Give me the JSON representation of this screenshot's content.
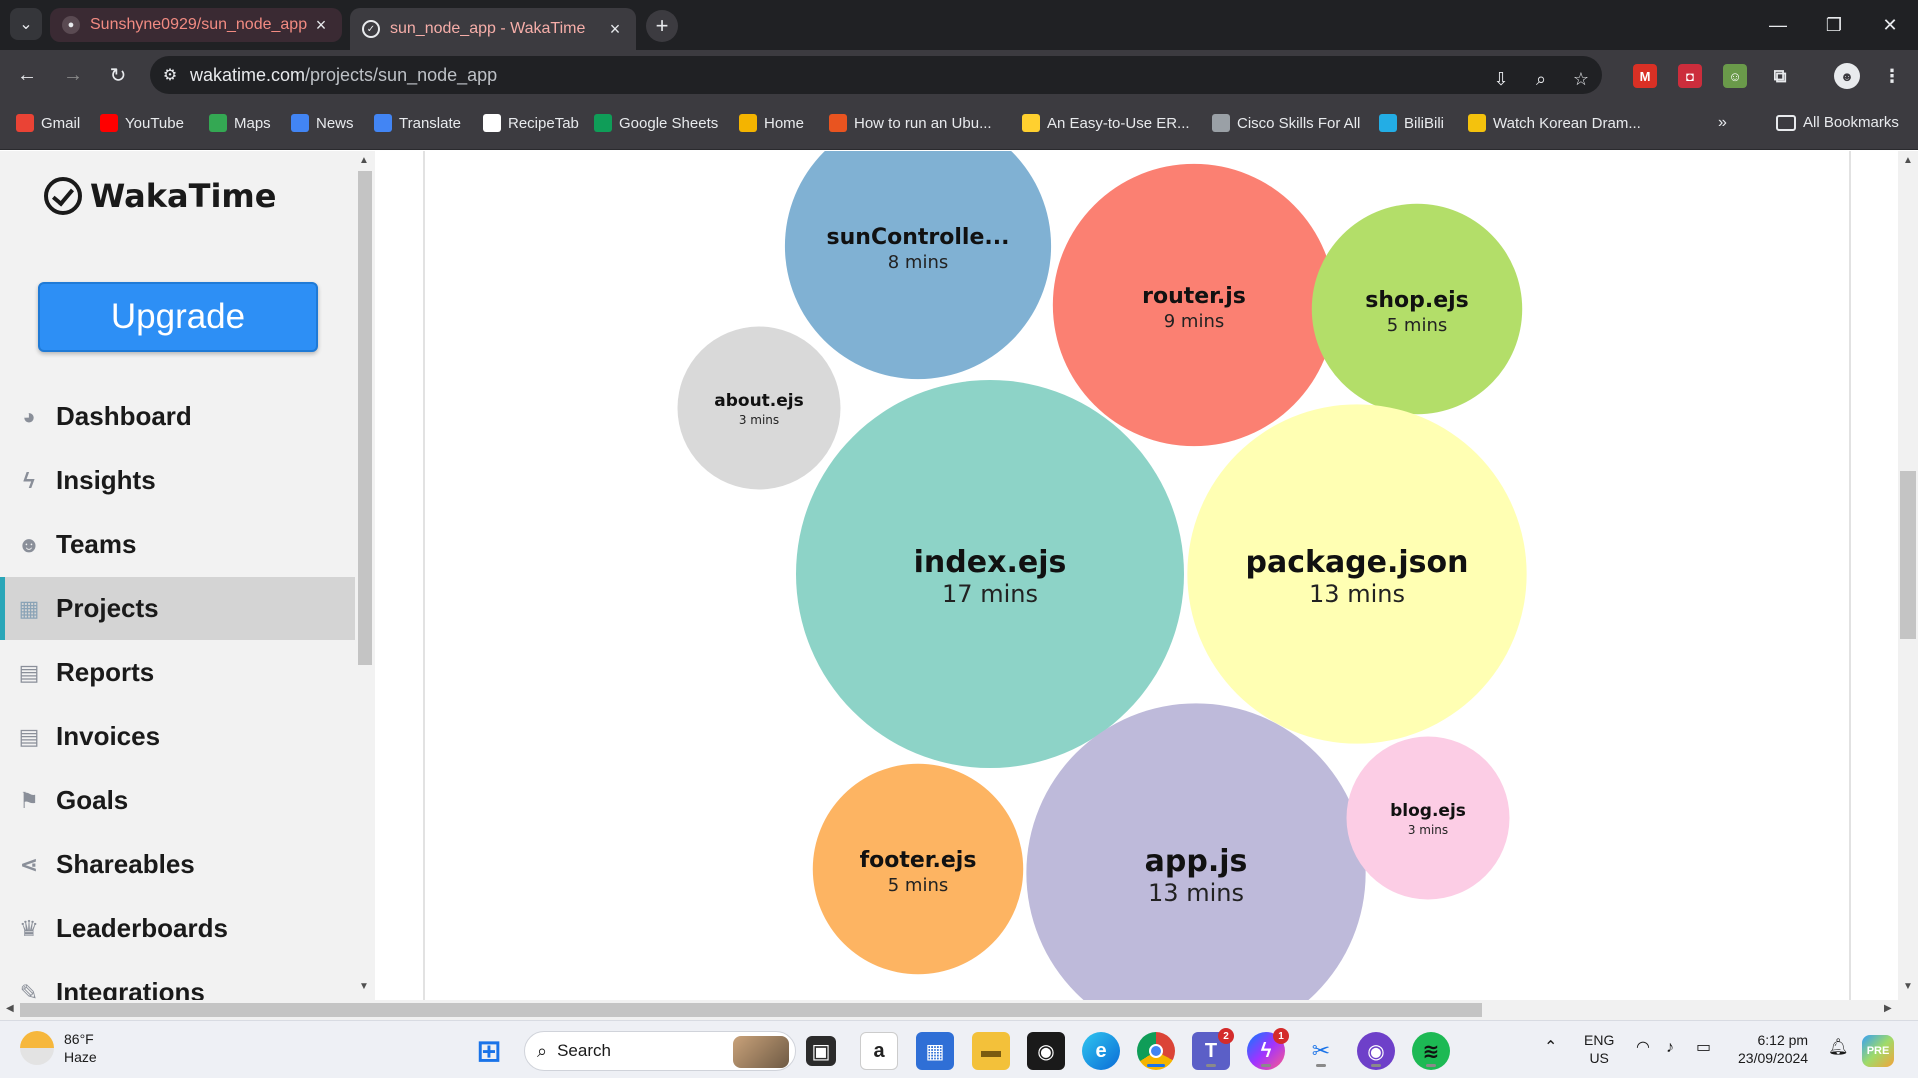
{
  "browser": {
    "tabs": [
      {
        "title": "Sunshyne0929/sun_node_app",
        "active": false,
        "icon": "github-icon"
      },
      {
        "title": "sun_node_app - WakaTime",
        "active": true,
        "icon": "wakatime-icon"
      }
    ],
    "url_host": "wakatime.com",
    "url_path": "/projects/sun_node_app",
    "bookmarks": [
      {
        "label": "Gmail",
        "icon": "gmail-icon",
        "color": "#ea4335"
      },
      {
        "label": "YouTube",
        "icon": "youtube-icon",
        "color": "#ff0000"
      },
      {
        "label": "Maps",
        "icon": "maps-icon",
        "color": "#34a853"
      },
      {
        "label": "News",
        "icon": "news-icon",
        "color": "#4285f4"
      },
      {
        "label": "Translate",
        "icon": "translate-icon",
        "color": "#4285f4"
      },
      {
        "label": "RecipeTab",
        "icon": "google-icon",
        "color": "#ffffff"
      },
      {
        "label": "Google Sheets",
        "icon": "sheets-icon",
        "color": "#0f9d58"
      },
      {
        "label": "Home",
        "icon": "home-icon",
        "color": "#f4b400"
      },
      {
        "label": "How to run an Ubu...",
        "icon": "ubuntu-icon",
        "color": "#e95420"
      },
      {
        "label": "An Easy-to-Use ER...",
        "icon": "miro-icon",
        "color": "#ffd02f"
      },
      {
        "label": "Cisco Skills For All",
        "icon": "cisco-icon",
        "color": "#9aa0a6"
      },
      {
        "label": "BiliBili",
        "icon": "bilibili-icon",
        "color": "#23ade5"
      },
      {
        "label": "Watch Korean Dram...",
        "icon": "play-icon",
        "color": "#f4c20d"
      }
    ],
    "all_bookmarks_label": "All Bookmarks"
  },
  "sidebar": {
    "brand": "WakaTime",
    "upgrade_label": "Upgrade",
    "items": [
      {
        "label": "Dashboard",
        "icon": "dashboard-icon",
        "glyph": "◕",
        "active": false
      },
      {
        "label": "Insights",
        "icon": "bolt-icon",
        "glyph": "ϟ",
        "active": false
      },
      {
        "label": "Teams",
        "icon": "users-icon",
        "glyph": "☻",
        "active": false
      },
      {
        "label": "Projects",
        "icon": "grid-icon",
        "glyph": "▦",
        "active": true
      },
      {
        "label": "Reports",
        "icon": "pdf-file-icon",
        "glyph": "▤",
        "active": false
      },
      {
        "label": "Invoices",
        "icon": "file-text-icon",
        "glyph": "▤",
        "active": false
      },
      {
        "label": "Goals",
        "icon": "flag-icon",
        "glyph": "⚑",
        "active": false
      },
      {
        "label": "Shareables",
        "icon": "share-icon",
        "glyph": "⋖",
        "active": false
      },
      {
        "label": "Leaderboards",
        "icon": "trophy-icon",
        "glyph": "♛",
        "active": false
      },
      {
        "label": "Integrations",
        "icon": "wrench-icon",
        "glyph": "✎",
        "active": false
      }
    ]
  },
  "chart_data": {
    "type": "bubble",
    "unit": "mins",
    "files": [
      {
        "name": "sunControlle...",
        "minutes": 8,
        "label": "8 mins",
        "color": "#80b1d3"
      },
      {
        "name": "router.js",
        "minutes": 9,
        "label": "9 mins",
        "color": "#fb8072"
      },
      {
        "name": "shop.ejs",
        "minutes": 5,
        "label": "5 mins",
        "color": "#b3de69"
      },
      {
        "name": "about.ejs",
        "minutes": 3,
        "label": "3 mins",
        "color": "#d9d9d9"
      },
      {
        "name": "index.ejs",
        "minutes": 17,
        "label": "17 mins",
        "color": "#8dd3c7"
      },
      {
        "name": "package.json",
        "minutes": 13,
        "label": "13 mins",
        "color": "#ffffb3"
      },
      {
        "name": "footer.ejs",
        "minutes": 5,
        "label": "5 mins",
        "color": "#fdb462"
      },
      {
        "name": "app.js",
        "minutes": 13,
        "label": "13 mins",
        "color": "#bebada"
      },
      {
        "name": "blog.ejs",
        "minutes": 3,
        "label": "3 mins",
        "color": "#fccde5"
      }
    ]
  },
  "taskbar": {
    "weather_temp": "86°F",
    "weather_desc": "Haze",
    "search_placeholder": "Search",
    "lang_line1": "ENG",
    "lang_line2": "US",
    "time": "6:12 pm",
    "date": "23/09/2024",
    "teams_badge": "2",
    "messenger_badge": "1"
  }
}
